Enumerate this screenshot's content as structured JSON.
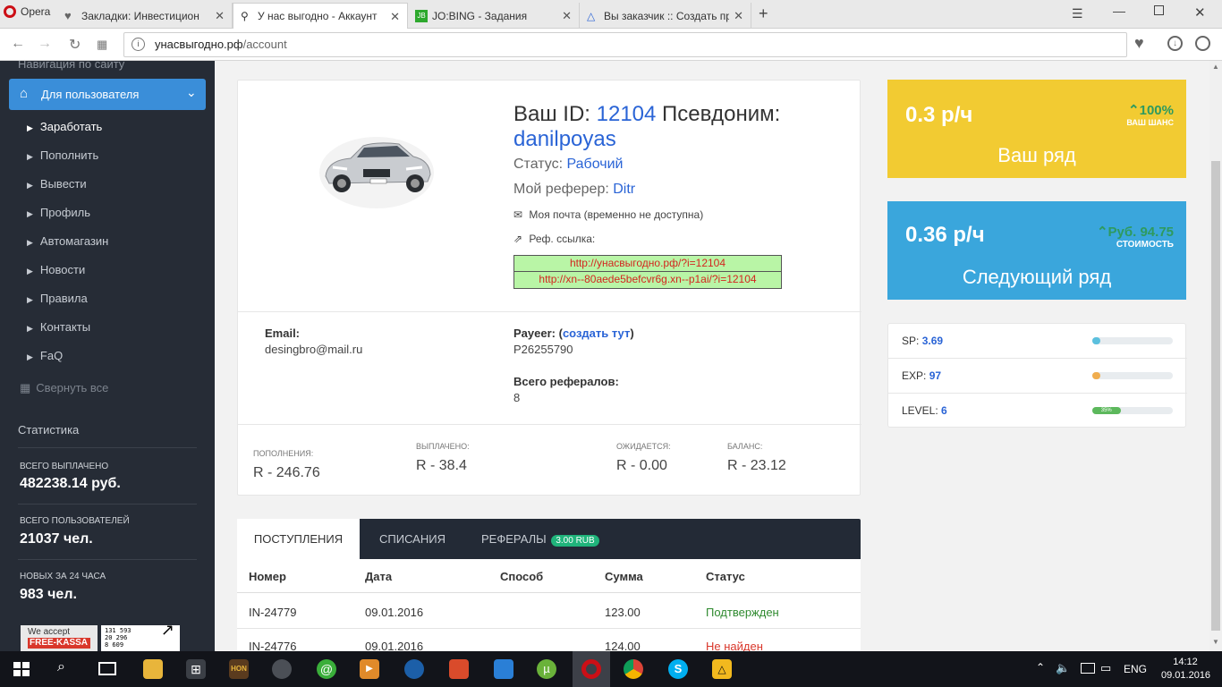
{
  "browser": {
    "tabs": [
      {
        "label": "Opera"
      },
      {
        "label": "Закладки: Инвестицион"
      },
      {
        "label": "У нас выгодно - Аккаунт"
      },
      {
        "label": "JO:BING - Задания"
      },
      {
        "label": "Вы заказчик :: Создать пр"
      }
    ],
    "url_domain": "унасвыгодно.рф",
    "url_path": "/account"
  },
  "sidebar": {
    "nav_heading": "Навигация по сайту",
    "active_item": "Для пользователя",
    "items": [
      "Заработать",
      "Пополнить",
      "Вывести",
      "Профиль",
      "Автомагазин",
      "Новости",
      "Правила",
      "Контакты",
      "FaQ"
    ],
    "collapse": "Свернуть все",
    "stats_heading": "Статистика",
    "stats": [
      {
        "label": "ВСЕГО ВЫПЛАЧЕНО",
        "value": "482238.14 руб."
      },
      {
        "label": "ВСЕГО ПОЛЬЗОВАТЕЛЕЙ",
        "value": "21037 чел."
      },
      {
        "label": "НОВЫХ ЗА 24 ЧАСА",
        "value": "983 чел."
      }
    ],
    "badge1_line1": "We accept",
    "badge1_line2": "FREE-KASSA",
    "counter_lines": [
      "131 593",
      "20 296",
      "8 609"
    ]
  },
  "profile": {
    "id_label": "Ваш ID:",
    "id_value": "12104",
    "nick_label": "Псевдоним:",
    "nick_value": "danilpoyas",
    "status_label": "Статус:",
    "status_value": "Рабочий",
    "referrer_label": "Мой реферер:",
    "referrer_value": "Ditr",
    "mail_text": "Моя почта (временно не доступна)",
    "ref_link_label": "Реф. ссылка:",
    "ref_link_1": "http://унасвыгодно.рф/?i=12104",
    "ref_link_2": "http://xn--80aede5befcvr6g.xn--p1ai/?i=12104",
    "email_label": "Email:",
    "email_value": "desingbro@mail.ru",
    "payeer_label": "Payeer:",
    "payeer_paren_open": "(",
    "payeer_link": "создать тут",
    "payeer_paren_close": ")",
    "payeer_value": "P26255790",
    "referrals_label": "Всего рефералов:",
    "referrals_value": "8"
  },
  "finance": [
    {
      "label": "ПОПОЛНЕНИЯ:",
      "value": "R - 246.76"
    },
    {
      "label": "ВЫПЛАЧЕНО:",
      "value": "R - 38.4"
    },
    {
      "label": "ОЖИДАЕТСЯ:",
      "value": "R - 0.00"
    },
    {
      "label": "БАЛАНС:",
      "value": "R - 23.12"
    }
  ],
  "tabs": {
    "items": [
      "ПОСТУПЛЕНИЯ",
      "СПИСАНИЯ",
      "РЕФЕРАЛЫ"
    ],
    "referrals_badge": "3.00 RUB"
  },
  "table": {
    "headers": [
      "Номер",
      "Дата",
      "Способ",
      "Сумма",
      "Статус"
    ],
    "rows": [
      {
        "num": "IN-24779",
        "date": "09.01.2016",
        "method": "",
        "sum": "123.00",
        "status": "Подтвержден"
      },
      {
        "num": "IN-24776",
        "date": "09.01.2016",
        "method": "",
        "sum": "124.00",
        "status": "Не найден"
      }
    ]
  },
  "widgets": {
    "current": {
      "rate": "0.3 р/ч",
      "pct": "100%",
      "pct_label": "ВАШ ШАНС",
      "title": "Ваш ряд",
      "color": "#f2cb32"
    },
    "next": {
      "rate": "0.36 р/ч",
      "price": "Руб. 94.75",
      "price_label": "СТОИМОСТЬ",
      "title": "Следующий ряд",
      "color": "#3aa6dc"
    }
  },
  "levels": [
    {
      "label": "SP:",
      "value": "3.69",
      "fill": 0.1,
      "color": "#5bc0de"
    },
    {
      "label": "EXP:",
      "value": "97",
      "fill": 0.1,
      "color": "#f0ad4e"
    },
    {
      "label": "LEVEL:",
      "value": "6",
      "fill": 0.35,
      "color": "#5cb85c",
      "bar_text": "35%"
    }
  ],
  "taskbar": {
    "lang": "ENG",
    "time": "14:12",
    "date": "09.01.2016"
  }
}
